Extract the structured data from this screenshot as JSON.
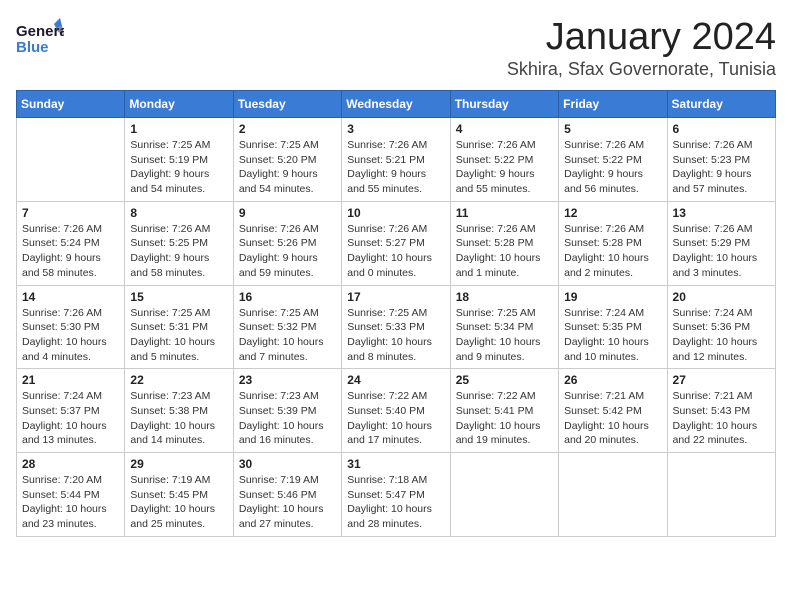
{
  "header": {
    "logo_general": "General",
    "logo_blue": "Blue",
    "month": "January 2024",
    "location": "Skhira, Sfax Governorate, Tunisia"
  },
  "days_of_week": [
    "Sunday",
    "Monday",
    "Tuesday",
    "Wednesday",
    "Thursday",
    "Friday",
    "Saturday"
  ],
  "weeks": [
    [
      {
        "day": "",
        "sunrise": "",
        "sunset": "",
        "daylight": ""
      },
      {
        "day": "1",
        "sunrise": "Sunrise: 7:25 AM",
        "sunset": "Sunset: 5:19 PM",
        "daylight": "Daylight: 9 hours and 54 minutes."
      },
      {
        "day": "2",
        "sunrise": "Sunrise: 7:25 AM",
        "sunset": "Sunset: 5:20 PM",
        "daylight": "Daylight: 9 hours and 54 minutes."
      },
      {
        "day": "3",
        "sunrise": "Sunrise: 7:26 AM",
        "sunset": "Sunset: 5:21 PM",
        "daylight": "Daylight: 9 hours and 55 minutes."
      },
      {
        "day": "4",
        "sunrise": "Sunrise: 7:26 AM",
        "sunset": "Sunset: 5:22 PM",
        "daylight": "Daylight: 9 hours and 55 minutes."
      },
      {
        "day": "5",
        "sunrise": "Sunrise: 7:26 AM",
        "sunset": "Sunset: 5:22 PM",
        "daylight": "Daylight: 9 hours and 56 minutes."
      },
      {
        "day": "6",
        "sunrise": "Sunrise: 7:26 AM",
        "sunset": "Sunset: 5:23 PM",
        "daylight": "Daylight: 9 hours and 57 minutes."
      }
    ],
    [
      {
        "day": "7",
        "sunrise": "Sunrise: 7:26 AM",
        "sunset": "Sunset: 5:24 PM",
        "daylight": "Daylight: 9 hours and 58 minutes."
      },
      {
        "day": "8",
        "sunrise": "Sunrise: 7:26 AM",
        "sunset": "Sunset: 5:25 PM",
        "daylight": "Daylight: 9 hours and 58 minutes."
      },
      {
        "day": "9",
        "sunrise": "Sunrise: 7:26 AM",
        "sunset": "Sunset: 5:26 PM",
        "daylight": "Daylight: 9 hours and 59 minutes."
      },
      {
        "day": "10",
        "sunrise": "Sunrise: 7:26 AM",
        "sunset": "Sunset: 5:27 PM",
        "daylight": "Daylight: 10 hours and 0 minutes."
      },
      {
        "day": "11",
        "sunrise": "Sunrise: 7:26 AM",
        "sunset": "Sunset: 5:28 PM",
        "daylight": "Daylight: 10 hours and 1 minute."
      },
      {
        "day": "12",
        "sunrise": "Sunrise: 7:26 AM",
        "sunset": "Sunset: 5:28 PM",
        "daylight": "Daylight: 10 hours and 2 minutes."
      },
      {
        "day": "13",
        "sunrise": "Sunrise: 7:26 AM",
        "sunset": "Sunset: 5:29 PM",
        "daylight": "Daylight: 10 hours and 3 minutes."
      }
    ],
    [
      {
        "day": "14",
        "sunrise": "Sunrise: 7:26 AM",
        "sunset": "Sunset: 5:30 PM",
        "daylight": "Daylight: 10 hours and 4 minutes."
      },
      {
        "day": "15",
        "sunrise": "Sunrise: 7:25 AM",
        "sunset": "Sunset: 5:31 PM",
        "daylight": "Daylight: 10 hours and 5 minutes."
      },
      {
        "day": "16",
        "sunrise": "Sunrise: 7:25 AM",
        "sunset": "Sunset: 5:32 PM",
        "daylight": "Daylight: 10 hours and 7 minutes."
      },
      {
        "day": "17",
        "sunrise": "Sunrise: 7:25 AM",
        "sunset": "Sunset: 5:33 PM",
        "daylight": "Daylight: 10 hours and 8 minutes."
      },
      {
        "day": "18",
        "sunrise": "Sunrise: 7:25 AM",
        "sunset": "Sunset: 5:34 PM",
        "daylight": "Daylight: 10 hours and 9 minutes."
      },
      {
        "day": "19",
        "sunrise": "Sunrise: 7:24 AM",
        "sunset": "Sunset: 5:35 PM",
        "daylight": "Daylight: 10 hours and 10 minutes."
      },
      {
        "day": "20",
        "sunrise": "Sunrise: 7:24 AM",
        "sunset": "Sunset: 5:36 PM",
        "daylight": "Daylight: 10 hours and 12 minutes."
      }
    ],
    [
      {
        "day": "21",
        "sunrise": "Sunrise: 7:24 AM",
        "sunset": "Sunset: 5:37 PM",
        "daylight": "Daylight: 10 hours and 13 minutes."
      },
      {
        "day": "22",
        "sunrise": "Sunrise: 7:23 AM",
        "sunset": "Sunset: 5:38 PM",
        "daylight": "Daylight: 10 hours and 14 minutes."
      },
      {
        "day": "23",
        "sunrise": "Sunrise: 7:23 AM",
        "sunset": "Sunset: 5:39 PM",
        "daylight": "Daylight: 10 hours and 16 minutes."
      },
      {
        "day": "24",
        "sunrise": "Sunrise: 7:22 AM",
        "sunset": "Sunset: 5:40 PM",
        "daylight": "Daylight: 10 hours and 17 minutes."
      },
      {
        "day": "25",
        "sunrise": "Sunrise: 7:22 AM",
        "sunset": "Sunset: 5:41 PM",
        "daylight": "Daylight: 10 hours and 19 minutes."
      },
      {
        "day": "26",
        "sunrise": "Sunrise: 7:21 AM",
        "sunset": "Sunset: 5:42 PM",
        "daylight": "Daylight: 10 hours and 20 minutes."
      },
      {
        "day": "27",
        "sunrise": "Sunrise: 7:21 AM",
        "sunset": "Sunset: 5:43 PM",
        "daylight": "Daylight: 10 hours and 22 minutes."
      }
    ],
    [
      {
        "day": "28",
        "sunrise": "Sunrise: 7:20 AM",
        "sunset": "Sunset: 5:44 PM",
        "daylight": "Daylight: 10 hours and 23 minutes."
      },
      {
        "day": "29",
        "sunrise": "Sunrise: 7:19 AM",
        "sunset": "Sunset: 5:45 PM",
        "daylight": "Daylight: 10 hours and 25 minutes."
      },
      {
        "day": "30",
        "sunrise": "Sunrise: 7:19 AM",
        "sunset": "Sunset: 5:46 PM",
        "daylight": "Daylight: 10 hours and 27 minutes."
      },
      {
        "day": "31",
        "sunrise": "Sunrise: 7:18 AM",
        "sunset": "Sunset: 5:47 PM",
        "daylight": "Daylight: 10 hours and 28 minutes."
      },
      {
        "day": "",
        "sunrise": "",
        "sunset": "",
        "daylight": ""
      },
      {
        "day": "",
        "sunrise": "",
        "sunset": "",
        "daylight": ""
      },
      {
        "day": "",
        "sunrise": "",
        "sunset": "",
        "daylight": ""
      }
    ]
  ]
}
